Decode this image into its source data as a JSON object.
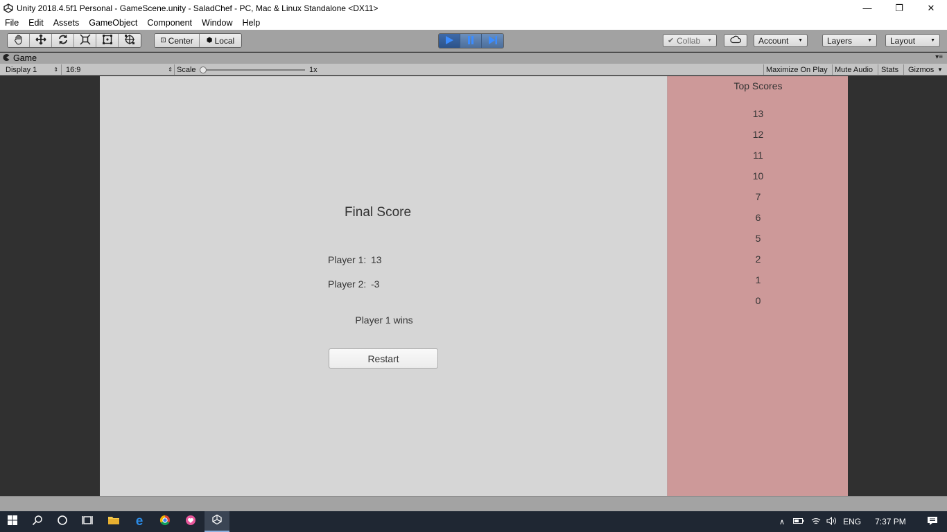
{
  "window": {
    "title": "Unity 2018.4.5f1 Personal - GameScene.unity - SaladChef - PC, Mac & Linux Standalone <DX11>",
    "minimize": "—",
    "restore": "❐",
    "close": "✕"
  },
  "menu": [
    "File",
    "Edit",
    "Assets",
    "GameObject",
    "Component",
    "Window",
    "Help"
  ],
  "toolbar": {
    "pivot_label": "Center",
    "space_label": "Local",
    "collab_label": "Collab",
    "account_label": "Account",
    "layers_label": "Layers",
    "layout_label": "Layout"
  },
  "game_panel": {
    "tab_label": "Game",
    "display_label": "Display 1",
    "aspect_label": "16:9",
    "scale_label": "Scale",
    "scale_value": "1x",
    "maximize_label": "Maximize On Play",
    "mute_label": "Mute Audio",
    "stats_label": "Stats",
    "gizmos_label": "Gizmos"
  },
  "game": {
    "final_title": "Final Score",
    "player1_label": "Player 1:",
    "player1_score": "13",
    "player2_label": "Player 2:",
    "player2_score": "-3",
    "result": "Player 1 wins",
    "restart_label": "Restart",
    "top_scores_title": "Top Scores",
    "top_scores": [
      "13",
      "12",
      "11",
      "10",
      "7",
      "6",
      "5",
      "2",
      "1",
      "0"
    ]
  },
  "taskbar": {
    "language": "ENG",
    "time": "7:37 PM"
  },
  "colors": {
    "play_active": "#2c538a",
    "game_bg": "#d6d6d6",
    "scores_bg": "#cd9999"
  }
}
